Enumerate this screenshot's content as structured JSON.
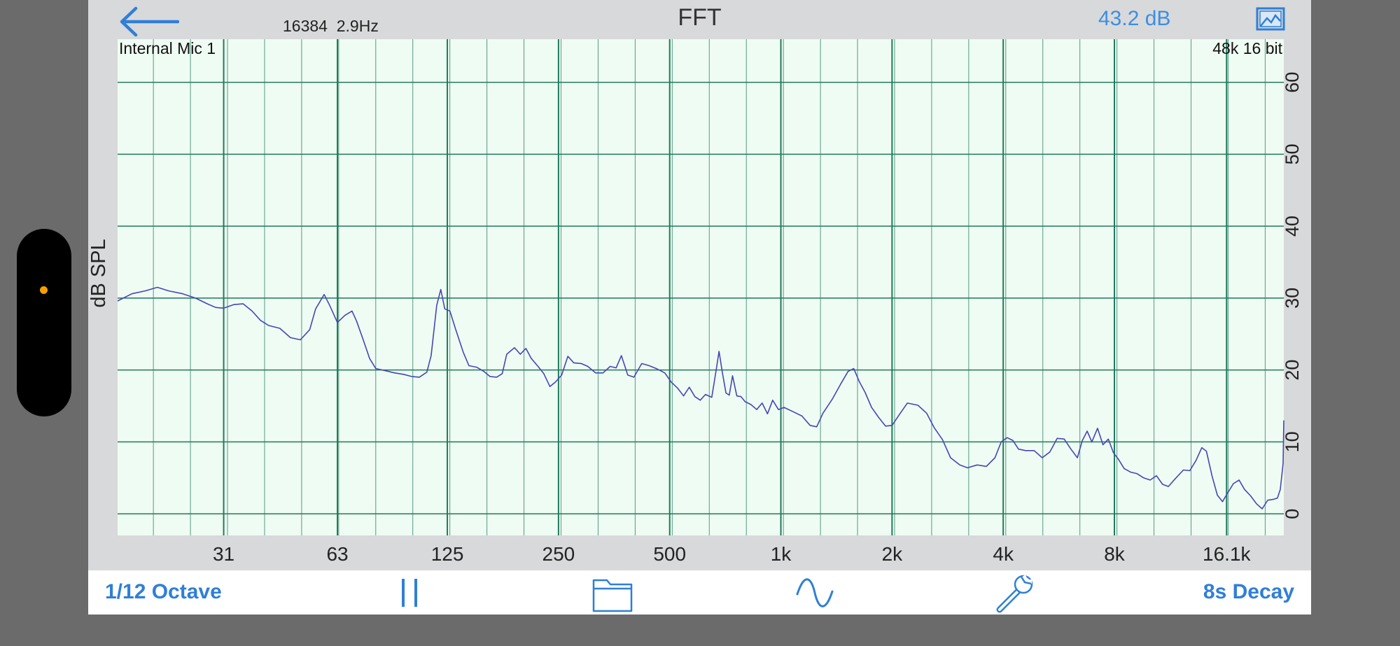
{
  "header": {
    "fft_size": "16384",
    "resolution": "2.9Hz",
    "title": "FFT",
    "level": "43.2 dB"
  },
  "icons": {
    "back": "back-arrow-icon",
    "image": "image-icon",
    "pause": "pause-icon",
    "folder": "folder-icon",
    "wave": "sine-wave-icon",
    "settings": "wrench-icon"
  },
  "footer": {
    "octave_label": "1/12 Octave",
    "decay_label": "8s Decay"
  },
  "colors": {
    "accent": "#2f7fd6",
    "level_blue": "#3d8ee0",
    "grid": "#1f7a5c",
    "plot_bg": "#effcf3",
    "trace": "#4646b4"
  },
  "chart_data": {
    "type": "line",
    "input_label": "Internal Mic 1",
    "format_label": "48k 16 bit",
    "ylabel": "dB SPL",
    "x_scale": "log",
    "xlim": [
      16,
      23000
    ],
    "ylim": [
      -3,
      66
    ],
    "grid": true,
    "x_ticks": [
      {
        "value": 31,
        "label": "31"
      },
      {
        "value": 63,
        "label": "63"
      },
      {
        "value": 125,
        "label": "125"
      },
      {
        "value": 250,
        "label": "250"
      },
      {
        "value": 500,
        "label": "500"
      },
      {
        "value": 1000,
        "label": "1k"
      },
      {
        "value": 2000,
        "label": "2k"
      },
      {
        "value": 4000,
        "label": "4k"
      },
      {
        "value": 8000,
        "label": "8k"
      },
      {
        "value": 16100,
        "label": "16.1k"
      }
    ],
    "y_ticks": [
      0,
      10,
      20,
      30,
      40,
      50,
      60
    ],
    "series": [
      {
        "points": [
          [
            16,
            29.6
          ],
          [
            17.5,
            30.6
          ],
          [
            19,
            31
          ],
          [
            20.5,
            31.5
          ],
          [
            22,
            31
          ],
          [
            24,
            30.6
          ],
          [
            26,
            30
          ],
          [
            28,
            29.2
          ],
          [
            29.5,
            28.7
          ],
          [
            31,
            28.6
          ],
          [
            33,
            29.1
          ],
          [
            35,
            29.2
          ],
          [
            37,
            28.2
          ],
          [
            39,
            26.9
          ],
          [
            41,
            26.2
          ],
          [
            44,
            25.8
          ],
          [
            47,
            24.5
          ],
          [
            50,
            24.2
          ],
          [
            53,
            25.6
          ],
          [
            55,
            28.5
          ],
          [
            58,
            30.5
          ],
          [
            60,
            29
          ],
          [
            63,
            26.6
          ],
          [
            66,
            27.6
          ],
          [
            69,
            28.2
          ],
          [
            71,
            26.8
          ],
          [
            74,
            24.2
          ],
          [
            77,
            21.6
          ],
          [
            80,
            20.2
          ],
          [
            85,
            19.9
          ],
          [
            90,
            19.6
          ],
          [
            95,
            19.4
          ],
          [
            100,
            19.1
          ],
          [
            105,
            19
          ],
          [
            110,
            19.7
          ],
          [
            113,
            22
          ],
          [
            117,
            29
          ],
          [
            120,
            31.2
          ],
          [
            123,
            28.5
          ],
          [
            127,
            28.2
          ],
          [
            132,
            25.5
          ],
          [
            138,
            22.5
          ],
          [
            143,
            20.6
          ],
          [
            150,
            20.4
          ],
          [
            157,
            19.8
          ],
          [
            163,
            19.1
          ],
          [
            170,
            19
          ],
          [
            176,
            19.5
          ],
          [
            181,
            22.2
          ],
          [
            190,
            23.1
          ],
          [
            197,
            22.2
          ],
          [
            204,
            23
          ],
          [
            211,
            21.6
          ],
          [
            220,
            20.5
          ],
          [
            228,
            19.5
          ],
          [
            237,
            17.7
          ],
          [
            245,
            18.3
          ],
          [
            255,
            19.3
          ],
          [
            265,
            21.9
          ],
          [
            275,
            21
          ],
          [
            288,
            20.9
          ],
          [
            300,
            20.5
          ],
          [
            315,
            19.6
          ],
          [
            330,
            19.6
          ],
          [
            345,
            20.5
          ],
          [
            358,
            20.3
          ],
          [
            370,
            22
          ],
          [
            385,
            19.3
          ],
          [
            400,
            19
          ],
          [
            420,
            20.9
          ],
          [
            440,
            20.6
          ],
          [
            460,
            20.2
          ],
          [
            485,
            19.6
          ],
          [
            505,
            18.3
          ],
          [
            525,
            17.5
          ],
          [
            545,
            16.4
          ],
          [
            565,
            17.6
          ],
          [
            585,
            16.3
          ],
          [
            605,
            15.8
          ],
          [
            625,
            16.6
          ],
          [
            650,
            16.2
          ],
          [
            668,
            20
          ],
          [
            680,
            22.6
          ],
          [
            695,
            19.5
          ],
          [
            710,
            16.8
          ],
          [
            725,
            16.5
          ],
          [
            740,
            19.2
          ],
          [
            760,
            16.4
          ],
          [
            780,
            16.3
          ],
          [
            800,
            15.6
          ],
          [
            830,
            15.2
          ],
          [
            860,
            14.5
          ],
          [
            890,
            15.4
          ],
          [
            920,
            13.9
          ],
          [
            950,
            15.8
          ],
          [
            985,
            14.5
          ],
          [
            1020,
            14.8
          ],
          [
            1080,
            14.2
          ],
          [
            1140,
            13.6
          ],
          [
            1200,
            12.3
          ],
          [
            1250,
            12.1
          ],
          [
            1300,
            14
          ],
          [
            1380,
            16
          ],
          [
            1450,
            18
          ],
          [
            1520,
            19.8
          ],
          [
            1575,
            20.2
          ],
          [
            1630,
            18.4
          ],
          [
            1690,
            16.9
          ],
          [
            1760,
            14.8
          ],
          [
            1840,
            13.4
          ],
          [
            1920,
            12.2
          ],
          [
            2000,
            12.3
          ],
          [
            2100,
            13.9
          ],
          [
            2200,
            15.4
          ],
          [
            2350,
            15.1
          ],
          [
            2480,
            14
          ],
          [
            2600,
            12
          ],
          [
            2740,
            10.3
          ],
          [
            2880,
            7.8
          ],
          [
            3050,
            6.8
          ],
          [
            3200,
            6.4
          ],
          [
            3400,
            6.8
          ],
          [
            3600,
            6.6
          ],
          [
            3800,
            7.8
          ],
          [
            3950,
            10
          ],
          [
            4100,
            10.6
          ],
          [
            4250,
            10.2
          ],
          [
            4400,
            9
          ],
          [
            4600,
            8.8
          ],
          [
            4850,
            8.8
          ],
          [
            5100,
            7.8
          ],
          [
            5350,
            8.6
          ],
          [
            5600,
            10.5
          ],
          [
            5850,
            10.4
          ],
          [
            6100,
            9
          ],
          [
            6350,
            7.8
          ],
          [
            6550,
            10.2
          ],
          [
            6750,
            11.5
          ],
          [
            6950,
            10
          ],
          [
            7200,
            11.9
          ],
          [
            7450,
            9.6
          ],
          [
            7700,
            10.4
          ],
          [
            7950,
            8.5
          ],
          [
            8200,
            7.6
          ],
          [
            8500,
            6.3
          ],
          [
            8850,
            5.8
          ],
          [
            9200,
            5.6
          ],
          [
            9600,
            5
          ],
          [
            10000,
            4.7
          ],
          [
            10400,
            5.3
          ],
          [
            10800,
            4.1
          ],
          [
            11200,
            3.8
          ],
          [
            11700,
            4.9
          ],
          [
            12300,
            6.1
          ],
          [
            12800,
            6
          ],
          [
            13300,
            7.4
          ],
          [
            13800,
            9.2
          ],
          [
            14200,
            8.7
          ],
          [
            14700,
            5.3
          ],
          [
            15200,
            2.6
          ],
          [
            15700,
            1.7
          ],
          [
            16200,
            2.9
          ],
          [
            16800,
            4.2
          ],
          [
            17400,
            4.7
          ],
          [
            18000,
            3.4
          ],
          [
            18700,
            2.5
          ],
          [
            19400,
            1.4
          ],
          [
            20100,
            0.7
          ],
          [
            20800,
            1.9
          ],
          [
            21500,
            2
          ],
          [
            22100,
            2.2
          ],
          [
            22500,
            3.4
          ],
          [
            22900,
            7
          ],
          [
            23000,
            13
          ]
        ]
      }
    ]
  }
}
